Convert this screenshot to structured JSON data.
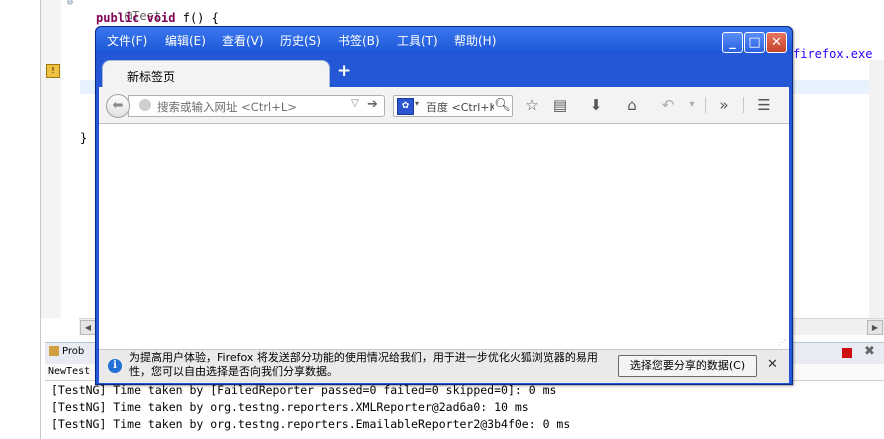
{
  "editor": {
    "line_annotation": "@Test",
    "line_method": "public void f() {",
    "line_kw1": "public",
    "line_kw2": "void",
    "line_rest": " f() {",
    "closing_brace": "}",
    "right_fragment": "firefox.exe"
  },
  "panel": {
    "tab_label": "Prob",
    "subheader": "NewTest"
  },
  "console": {
    "lines": [
      "[TestNG] Time taken by [FailedReporter passed=0 failed=0 skipped=0]: 0 ms",
      "[TestNG] Time taken by org.testng.reporters.XMLReporter@2ad6a0: 10 ms",
      "[TestNG] Time taken by org.testng.reporters.EmailableReporter2@3b4f0e: 0 ms"
    ]
  },
  "firefox": {
    "menu": [
      "文件(F)",
      "编辑(E)",
      "查看(V)",
      "历史(S)",
      "书签(B)",
      "工具(T)",
      "帮助(H)"
    ],
    "window_controls": {
      "minimize": "_",
      "maximize": "□",
      "close": "✕"
    },
    "tab_title": "新标签页",
    "new_tab": "+",
    "url_placeholder": "搜索或输入网址 <Ctrl+L>",
    "search_engine": "百度",
    "search_placeholder": "百度 <Ctrl+K>",
    "notification": {
      "text": "为提高用户体验，Firefox 将发送部分功能的使用情况给我们，用于进一步优化火狐浏览器的易用性，您可以自由选择是否向我们分享数据。",
      "button": "选择您要分享的数据(C)",
      "close": "✕"
    },
    "icons": [
      "back-arrow-icon",
      "globe-icon",
      "dropdown-icon",
      "go-arrow-icon",
      "baidu-paw-icon",
      "magnifier-icon",
      "star-icon",
      "reading-list-icon",
      "download-icon",
      "home-icon",
      "undo-icon",
      "overflow-icon",
      "hamburger-icon"
    ]
  },
  "colors": {
    "titlebar": "#2457d6",
    "close_button": "#c4422a",
    "keyword": "#7f0055",
    "string": "#2a00ff"
  }
}
